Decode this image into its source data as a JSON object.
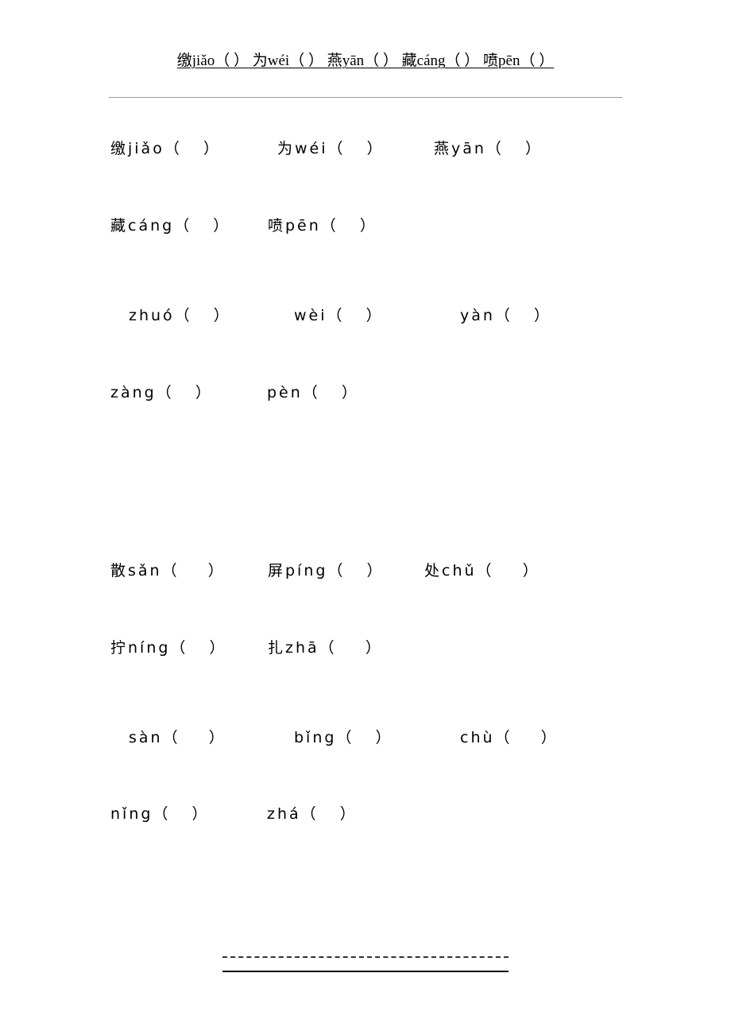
{
  "header": {
    "text": "缴jiǎo（ ） 为wéi（ ） 燕yān（ ） 藏cáng（ ） 喷pēn（ ）"
  },
  "section1": {
    "row1": [
      {
        "text": "缴jiǎo（   ）"
      },
      {
        "text": "为wéi（   ）"
      },
      {
        "text": "燕yān（   ）"
      }
    ],
    "row2": [
      {
        "text": "藏cáng（   ）"
      },
      {
        "text": "喷pēn（   ）"
      }
    ],
    "row3": [
      {
        "text": "zhuó（   ）"
      },
      {
        "text": "wèi（   ）"
      },
      {
        "text": "yàn（   ）"
      }
    ],
    "row4": [
      {
        "text": "zàng（   ）"
      },
      {
        "text": "pèn（   ）"
      }
    ]
  },
  "section2": {
    "row1": [
      {
        "text": "散sǎn（    ）"
      },
      {
        "text": "屏píng（   ）"
      },
      {
        "text": "处chǔ（    ）"
      }
    ],
    "row2": [
      {
        "text": "拧níng（   ）"
      },
      {
        "text": "扎zhā（    ）"
      }
    ],
    "row3": [
      {
        "text": "sàn（    ）"
      },
      {
        "text": "bǐng（   ）"
      },
      {
        "text": "chù（    ）"
      }
    ],
    "row4": [
      {
        "text": "nǐng（   ）"
      },
      {
        "text": "zhá（   ）"
      }
    ]
  }
}
